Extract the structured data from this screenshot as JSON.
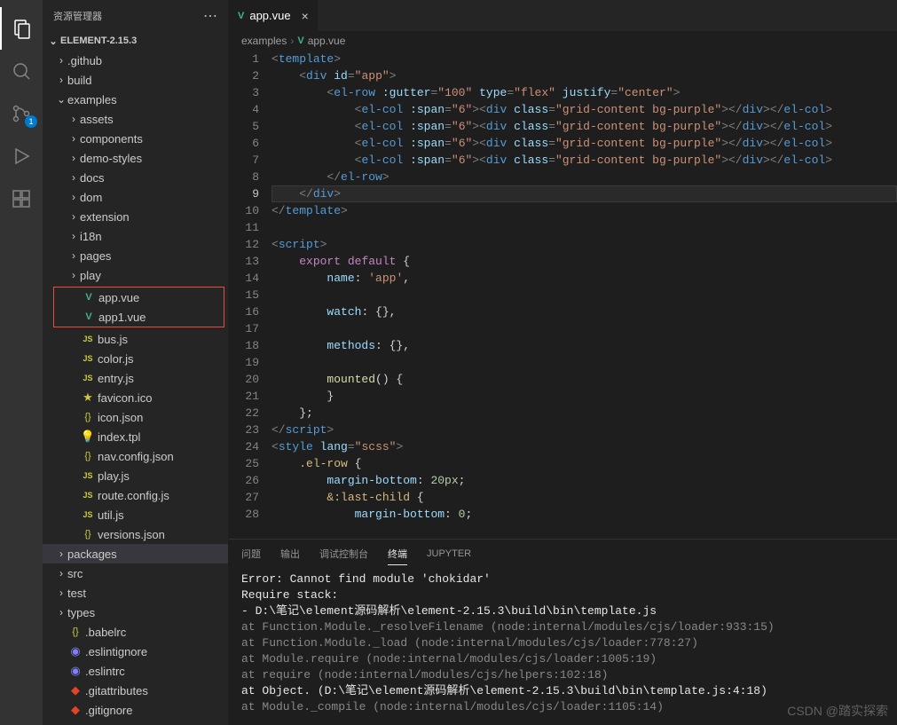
{
  "sidebar": {
    "title": "资源管理器",
    "project": "ELEMENT-2.15.3"
  },
  "activity": {
    "scm_badge": "1"
  },
  "tree": {
    "folders_top": [
      {
        "name": ".github"
      },
      {
        "name": "build"
      }
    ],
    "examples_label": "examples",
    "examples_folders": [
      "assets",
      "components",
      "demo-styles",
      "docs",
      "dom",
      "extension",
      "i18n",
      "pages",
      "play"
    ],
    "highlighted": [
      "app.vue",
      "app1.vue"
    ],
    "examples_files": [
      {
        "name": "bus.js",
        "icon": "js"
      },
      {
        "name": "color.js",
        "icon": "js"
      },
      {
        "name": "entry.js",
        "icon": "js"
      },
      {
        "name": "favicon.ico",
        "icon": "ico"
      },
      {
        "name": "icon.json",
        "icon": "json"
      },
      {
        "name": "index.tpl",
        "icon": "tpl"
      },
      {
        "name": "nav.config.json",
        "icon": "json"
      },
      {
        "name": "play.js",
        "icon": "js"
      },
      {
        "name": "route.config.js",
        "icon": "js"
      },
      {
        "name": "util.js",
        "icon": "js"
      },
      {
        "name": "versions.json",
        "icon": "json"
      }
    ],
    "folders_bottom": [
      "packages",
      "src",
      "test",
      "types"
    ],
    "root_files": [
      {
        "name": ".babelrc",
        "icon": "json"
      },
      {
        "name": ".eslintignore",
        "icon": "eslint"
      },
      {
        "name": ".eslintrc",
        "icon": "eslint"
      },
      {
        "name": ".gitattributes",
        "icon": "git"
      },
      {
        "name": ".gitignore",
        "icon": "git"
      }
    ]
  },
  "tab": {
    "file": "app.vue"
  },
  "breadcrumbs": {
    "folder": "examples",
    "file": "app.vue"
  },
  "code": {
    "lines": [
      {
        "n": 1,
        "html": "<span class='t-pun'>&lt;</span><span class='t-tag'>template</span><span class='t-pun'>&gt;</span>"
      },
      {
        "n": 2,
        "html": "    <span class='t-pun'>&lt;</span><span class='t-tag'>div</span> <span class='t-attr'>id</span><span class='t-pun'>=</span><span class='t-str'>\"app\"</span><span class='t-pun'>&gt;</span>"
      },
      {
        "n": 3,
        "html": "        <span class='t-pun'>&lt;</span><span class='t-tag'>el-row</span> <span class='t-attr'>:gutter</span><span class='t-pun'>=</span><span class='t-str'>\"100\"</span> <span class='t-attr'>type</span><span class='t-pun'>=</span><span class='t-str'>\"flex\"</span> <span class='t-attr'>justify</span><span class='t-pun'>=</span><span class='t-str'>\"center\"</span><span class='t-pun'>&gt;</span>"
      },
      {
        "n": 4,
        "html": "            <span class='t-pun'>&lt;</span><span class='t-tag'>el-col</span> <span class='t-attr'>:span</span><span class='t-pun'>=</span><span class='t-str'>\"6\"</span><span class='t-pun'>&gt;&lt;</span><span class='t-tag'>div</span> <span class='t-attr'>class</span><span class='t-pun'>=</span><span class='t-str'>\"grid-content bg-purple\"</span><span class='t-pun'>&gt;&lt;/</span><span class='t-tag'>div</span><span class='t-pun'>&gt;&lt;/</span><span class='t-tag'>el-col</span><span class='t-pun'>&gt;</span>"
      },
      {
        "n": 5,
        "html": "            <span class='t-pun'>&lt;</span><span class='t-tag'>el-col</span> <span class='t-attr'>:span</span><span class='t-pun'>=</span><span class='t-str'>\"6\"</span><span class='t-pun'>&gt;&lt;</span><span class='t-tag'>div</span> <span class='t-attr'>class</span><span class='t-pun'>=</span><span class='t-str'>\"grid-content bg-purple\"</span><span class='t-pun'>&gt;&lt;/</span><span class='t-tag'>div</span><span class='t-pun'>&gt;&lt;/</span><span class='t-tag'>el-col</span><span class='t-pun'>&gt;</span>"
      },
      {
        "n": 6,
        "html": "            <span class='t-pun'>&lt;</span><span class='t-tag'>el-col</span> <span class='t-attr'>:span</span><span class='t-pun'>=</span><span class='t-str'>\"6\"</span><span class='t-pun'>&gt;&lt;</span><span class='t-tag'>div</span> <span class='t-attr'>class</span><span class='t-pun'>=</span><span class='t-str'>\"grid-content bg-purple\"</span><span class='t-pun'>&gt;&lt;/</span><span class='t-tag'>div</span><span class='t-pun'>&gt;&lt;/</span><span class='t-tag'>el-col</span><span class='t-pun'>&gt;</span>"
      },
      {
        "n": 7,
        "html": "            <span class='t-pun'>&lt;</span><span class='t-tag'>el-col</span> <span class='t-attr'>:span</span><span class='t-pun'>=</span><span class='t-str'>\"6\"</span><span class='t-pun'>&gt;&lt;</span><span class='t-tag'>div</span> <span class='t-attr'>class</span><span class='t-pun'>=</span><span class='t-str'>\"grid-content bg-purple\"</span><span class='t-pun'>&gt;&lt;/</span><span class='t-tag'>div</span><span class='t-pun'>&gt;&lt;/</span><span class='t-tag'>el-col</span><span class='t-pun'>&gt;</span>"
      },
      {
        "n": 8,
        "html": "        <span class='t-pun'>&lt;/</span><span class='t-tag'>el-row</span><span class='t-pun'>&gt;</span>"
      },
      {
        "n": 9,
        "html": "    <span class='t-pun'>&lt;/</span><span class='t-tag'>div</span><span class='t-pun'>&gt;</span>",
        "current": true
      },
      {
        "n": 10,
        "html": "<span class='t-pun'>&lt;/</span><span class='t-tag'>template</span><span class='t-pun'>&gt;</span>"
      },
      {
        "n": 11,
        "html": ""
      },
      {
        "n": 12,
        "html": "<span class='t-pun'>&lt;</span><span class='t-tag'>script</span><span class='t-pun'>&gt;</span>"
      },
      {
        "n": 13,
        "html": "    <span class='t-kw'>export</span> <span class='t-kw'>default</span> <span class='t-txt'>{</span>"
      },
      {
        "n": 14,
        "html": "        <span class='t-prop'>name</span><span class='t-txt'>: </span><span class='t-str'>'app'</span><span class='t-txt'>,</span>"
      },
      {
        "n": 15,
        "html": ""
      },
      {
        "n": 16,
        "html": "        <span class='t-prop'>watch</span><span class='t-txt'>: {},</span>"
      },
      {
        "n": 17,
        "html": ""
      },
      {
        "n": 18,
        "html": "        <span class='t-prop'>methods</span><span class='t-txt'>: {},</span>"
      },
      {
        "n": 19,
        "html": ""
      },
      {
        "n": 20,
        "html": "        <span class='t-id'>mounted</span><span class='t-txt'>() {</span>"
      },
      {
        "n": 21,
        "html": "        <span class='t-txt'>}</span>"
      },
      {
        "n": 22,
        "html": "    <span class='t-txt'>};</span>"
      },
      {
        "n": 23,
        "html": "<span class='t-pun'>&lt;/</span><span class='t-tag'>script</span><span class='t-pun'>&gt;</span>"
      },
      {
        "n": 24,
        "html": "<span class='t-pun'>&lt;</span><span class='t-tag'>style</span> <span class='t-attr'>lang</span><span class='t-pun'>=</span><span class='t-str'>\"scss\"</span><span class='t-pun'>&gt;</span>"
      },
      {
        "n": 25,
        "html": "    <span class='t-sel'>.el-row</span> <span class='t-txt'>{</span>"
      },
      {
        "n": 26,
        "html": "        <span class='t-prop'>margin-bottom</span><span class='t-txt'>: </span><span class='t-num'>20px</span><span class='t-txt'>;</span>"
      },
      {
        "n": 27,
        "html": "        <span class='t-sel'>&amp;:last-child</span> <span class='t-txt'>{</span>"
      },
      {
        "n": 28,
        "html": "            <span class='t-prop'>margin-bottom</span><span class='t-txt'>: </span><span class='t-num'>0</span><span class='t-txt'>;</span>"
      }
    ]
  },
  "terminal": {
    "tabs": [
      "问题",
      "输出",
      "调试控制台",
      "终端",
      "JUPYTER"
    ],
    "active_tab": 3,
    "lines": [
      {
        "text": "Error: Cannot find module 'chokidar'",
        "cls": "hl"
      },
      {
        "text": "Require stack:",
        "cls": "hl"
      },
      {
        "text": "- D:\\笔记\\element源码解析\\element-2.15.3\\build\\bin\\template.js",
        "cls": "hl"
      },
      {
        "text": "    at Function.Module._resolveFilename (node:internal/modules/cjs/loader:933:15)",
        "cls": "dim"
      },
      {
        "text": "    at Function.Module._load (node:internal/modules/cjs/loader:778:27)",
        "cls": "dim"
      },
      {
        "text": "    at Module.require (node:internal/modules/cjs/loader:1005:19)",
        "cls": "dim"
      },
      {
        "text": "    at require (node:internal/modules/cjs/helpers:102:18)",
        "cls": "dim"
      },
      {
        "text": "    at Object.<anonymous> (D:\\笔记\\element源码解析\\element-2.15.3\\build\\bin\\template.js:4:18)",
        "cls": "hl"
      },
      {
        "text": "    at Module._compile (node:internal/modules/cjs/loader:1105:14)",
        "cls": "dim"
      }
    ]
  },
  "watermark": "CSDN @踏实探索"
}
